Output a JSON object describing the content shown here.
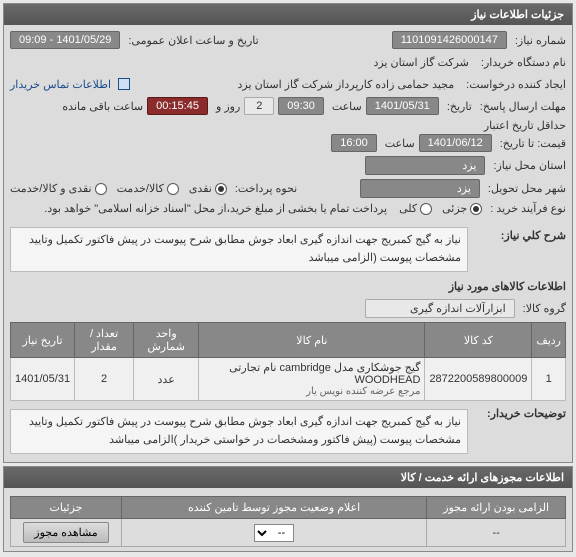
{
  "panel1_title": "جزئیات اطلاعات نیاز",
  "labels": {
    "need_no": "شماره نیاز:",
    "announce_date": "تاریخ و ساعت اعلان عمومی:",
    "buyer_device": "نام دستگاه خریدار:",
    "request_creator": "ایجاد کننده درخواست:",
    "buyer_contact_link": "اطلاعات تماس خریدار",
    "response_deadline": "مهلت ارسال پاسخ:",
    "from_date": "تاریخ:",
    "time": "ساعت",
    "day_and": "روز و",
    "remaining": "ساعت باقی مانده",
    "min_validity_date": "حداقل تاریخ اعتبار",
    "to_date": "قیمت: تا تاریخ:",
    "need_city": "استان محل نیاز:",
    "delivery_city": "شهر محل تحویل:",
    "pay_method": "نحوه پرداخت:",
    "buy_process": "نوع فرآیند خرید :",
    "need_desc_title": "شرح کلي نیاز:",
    "goods_title": "اطلاعات کالاهای مورد نیاز",
    "goods_group": "گروه کالا:",
    "buyer_notes": "توضیحات خریدار:"
  },
  "need_no": "1101091426000147",
  "announce_date": "1401/05/29 - 09:09",
  "buyer_device": "شرکت گاز استان یزد",
  "request_creator": "مجید حمامی زاده کارپرداز شرکت گاز استان یزد",
  "deadline_date": "1401/05/31",
  "deadline_time": "09:30",
  "deadline_days": "2",
  "deadline_remaining": "00:15:45",
  "validity_date": "1401/06/12",
  "validity_time": "16:00",
  "need_city": "یزد",
  "delivery_city": "یزد",
  "pay_options": [
    "نقدی",
    "کالا/خدمت",
    "نقدی و کالا/خدمت"
  ],
  "pay_selected_index": 0,
  "buy_options": [
    "جزئی",
    "کلی"
  ],
  "buy_selected_index": 0,
  "buy_note": "پرداخت تمام یا بخشی از مبلغ خرید،از محل \"اسناد خزانه اسلامی\" خواهد بود.",
  "need_desc": "نیاز به گیج کمبریج جهت اندازه گیری ابعاد جوش مطابق شرح پیوست در پیش فاکتور تکمیل وتایید مشخصات پیوست (الزامی میباشد",
  "goods_group_value": "ابزارآلات اندازه گیری",
  "table": {
    "headers": [
      "ردیف",
      "کد کالا",
      "نام کالا",
      "واحد شمارش",
      "تعداد / مقدار",
      "تاریخ نیاز"
    ],
    "row": {
      "idx": "1",
      "code": "2872200589800009",
      "name": "گیج جوشکاری مدل cambridge نام تجارتی WOODHEAD",
      "name_sub": "مرجع عرضه کننده نویس یار",
      "unit": "عدد",
      "qty": "2",
      "date": "1401/05/31"
    }
  },
  "buyer_notes": "نیاز به گیج کمبریج جهت اندازه گیری ابعاد جوش مطابق شرح پیوست در پیش فاکتور تکمیل وتایید مشخصات پیوست (پیش فاکتور ومشخصات در خواستی خریدار )الزامی میباشد",
  "panel2_title": "اطلاعات مجوزهای ارائه خدمت / کالا",
  "perm": {
    "headers": [
      "الزامی بودن ارائه مجوز",
      "اعلام وضعیت مجوز توسط تامین کننده",
      "جزئیات"
    ],
    "mandatory": "--",
    "select_value": "--",
    "detail_btn": "مشاهده مجوز"
  }
}
